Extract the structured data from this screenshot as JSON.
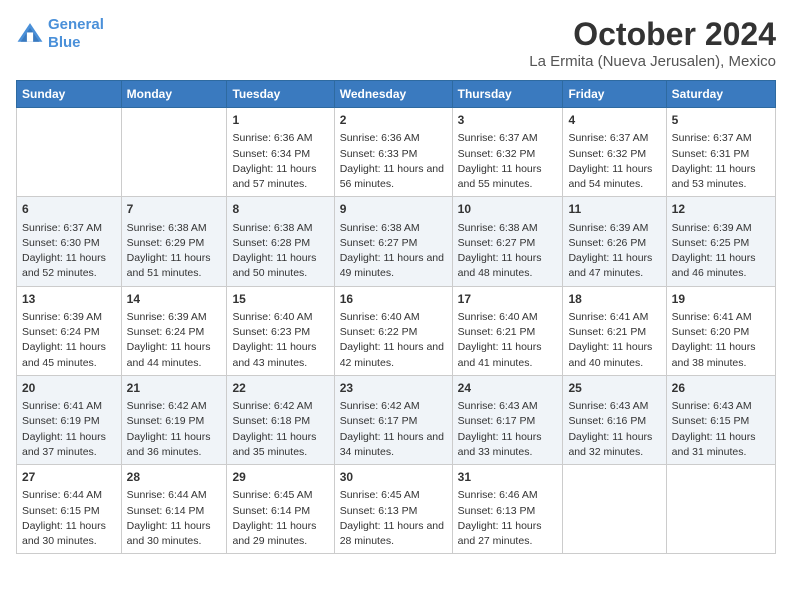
{
  "logo": {
    "line1": "General",
    "line2": "Blue"
  },
  "title": "October 2024",
  "subtitle": "La Ermita (Nueva Jerusalen), Mexico",
  "days_of_week": [
    "Sunday",
    "Monday",
    "Tuesday",
    "Wednesday",
    "Thursday",
    "Friday",
    "Saturday"
  ],
  "weeks": [
    [
      {
        "day": "",
        "content": ""
      },
      {
        "day": "",
        "content": ""
      },
      {
        "day": "1",
        "content": "Sunrise: 6:36 AM\nSunset: 6:34 PM\nDaylight: 11 hours and 57 minutes."
      },
      {
        "day": "2",
        "content": "Sunrise: 6:36 AM\nSunset: 6:33 PM\nDaylight: 11 hours and 56 minutes."
      },
      {
        "day": "3",
        "content": "Sunrise: 6:37 AM\nSunset: 6:32 PM\nDaylight: 11 hours and 55 minutes."
      },
      {
        "day": "4",
        "content": "Sunrise: 6:37 AM\nSunset: 6:32 PM\nDaylight: 11 hours and 54 minutes."
      },
      {
        "day": "5",
        "content": "Sunrise: 6:37 AM\nSunset: 6:31 PM\nDaylight: 11 hours and 53 minutes."
      }
    ],
    [
      {
        "day": "6",
        "content": "Sunrise: 6:37 AM\nSunset: 6:30 PM\nDaylight: 11 hours and 52 minutes."
      },
      {
        "day": "7",
        "content": "Sunrise: 6:38 AM\nSunset: 6:29 PM\nDaylight: 11 hours and 51 minutes."
      },
      {
        "day": "8",
        "content": "Sunrise: 6:38 AM\nSunset: 6:28 PM\nDaylight: 11 hours and 50 minutes."
      },
      {
        "day": "9",
        "content": "Sunrise: 6:38 AM\nSunset: 6:27 PM\nDaylight: 11 hours and 49 minutes."
      },
      {
        "day": "10",
        "content": "Sunrise: 6:38 AM\nSunset: 6:27 PM\nDaylight: 11 hours and 48 minutes."
      },
      {
        "day": "11",
        "content": "Sunrise: 6:39 AM\nSunset: 6:26 PM\nDaylight: 11 hours and 47 minutes."
      },
      {
        "day": "12",
        "content": "Sunrise: 6:39 AM\nSunset: 6:25 PM\nDaylight: 11 hours and 46 minutes."
      }
    ],
    [
      {
        "day": "13",
        "content": "Sunrise: 6:39 AM\nSunset: 6:24 PM\nDaylight: 11 hours and 45 minutes."
      },
      {
        "day": "14",
        "content": "Sunrise: 6:39 AM\nSunset: 6:24 PM\nDaylight: 11 hours and 44 minutes."
      },
      {
        "day": "15",
        "content": "Sunrise: 6:40 AM\nSunset: 6:23 PM\nDaylight: 11 hours and 43 minutes."
      },
      {
        "day": "16",
        "content": "Sunrise: 6:40 AM\nSunset: 6:22 PM\nDaylight: 11 hours and 42 minutes."
      },
      {
        "day": "17",
        "content": "Sunrise: 6:40 AM\nSunset: 6:21 PM\nDaylight: 11 hours and 41 minutes."
      },
      {
        "day": "18",
        "content": "Sunrise: 6:41 AM\nSunset: 6:21 PM\nDaylight: 11 hours and 40 minutes."
      },
      {
        "day": "19",
        "content": "Sunrise: 6:41 AM\nSunset: 6:20 PM\nDaylight: 11 hours and 38 minutes."
      }
    ],
    [
      {
        "day": "20",
        "content": "Sunrise: 6:41 AM\nSunset: 6:19 PM\nDaylight: 11 hours and 37 minutes."
      },
      {
        "day": "21",
        "content": "Sunrise: 6:42 AM\nSunset: 6:19 PM\nDaylight: 11 hours and 36 minutes."
      },
      {
        "day": "22",
        "content": "Sunrise: 6:42 AM\nSunset: 6:18 PM\nDaylight: 11 hours and 35 minutes."
      },
      {
        "day": "23",
        "content": "Sunrise: 6:42 AM\nSunset: 6:17 PM\nDaylight: 11 hours and 34 minutes."
      },
      {
        "day": "24",
        "content": "Sunrise: 6:43 AM\nSunset: 6:17 PM\nDaylight: 11 hours and 33 minutes."
      },
      {
        "day": "25",
        "content": "Sunrise: 6:43 AM\nSunset: 6:16 PM\nDaylight: 11 hours and 32 minutes."
      },
      {
        "day": "26",
        "content": "Sunrise: 6:43 AM\nSunset: 6:15 PM\nDaylight: 11 hours and 31 minutes."
      }
    ],
    [
      {
        "day": "27",
        "content": "Sunrise: 6:44 AM\nSunset: 6:15 PM\nDaylight: 11 hours and 30 minutes."
      },
      {
        "day": "28",
        "content": "Sunrise: 6:44 AM\nSunset: 6:14 PM\nDaylight: 11 hours and 30 minutes."
      },
      {
        "day": "29",
        "content": "Sunrise: 6:45 AM\nSunset: 6:14 PM\nDaylight: 11 hours and 29 minutes."
      },
      {
        "day": "30",
        "content": "Sunrise: 6:45 AM\nSunset: 6:13 PM\nDaylight: 11 hours and 28 minutes."
      },
      {
        "day": "31",
        "content": "Sunrise: 6:46 AM\nSunset: 6:13 PM\nDaylight: 11 hours and 27 minutes."
      },
      {
        "day": "",
        "content": ""
      },
      {
        "day": "",
        "content": ""
      }
    ]
  ]
}
